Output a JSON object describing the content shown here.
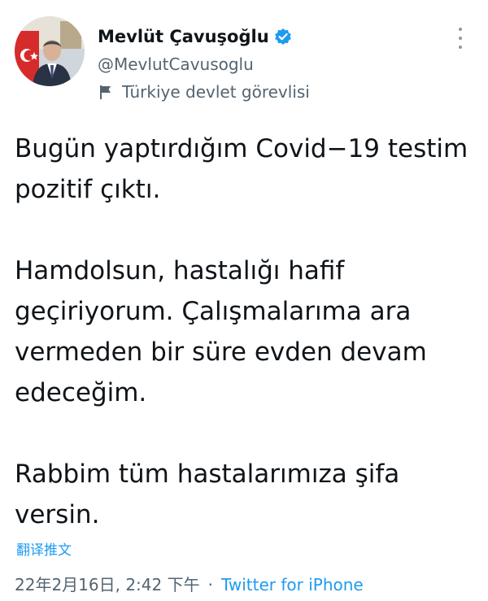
{
  "author": {
    "display_name": "Mevlüt Çavuşoğlu",
    "handle": "@MevlutCavusoglu",
    "affiliation_label": "Türkiye devlet görevlisi",
    "verified": true,
    "verified_icon": "verified-badge-icon",
    "affiliation_icon": "flag-icon"
  },
  "tweet": {
    "paragraphs": [
      "Bugün yaptırdığım Covid−19 testim\npozitif çıktı.",
      "Hamdolsun, hastalığı hafif\ngeçiriyorum. Çalışmalarıma ara\nvermeden bir süre evden devam\nedeceğim.",
      "Rabbim tüm hastalarımıza şifa\nversin."
    ],
    "translate_label": "翻译推文",
    "timestamp": "22年2月16日, 2:42 下午",
    "separator": "·",
    "source": "Twitter for iPhone"
  },
  "colors": {
    "accent": "#1d9bf0",
    "secondary_text": "#536471",
    "primary_text": "#0f1419"
  }
}
